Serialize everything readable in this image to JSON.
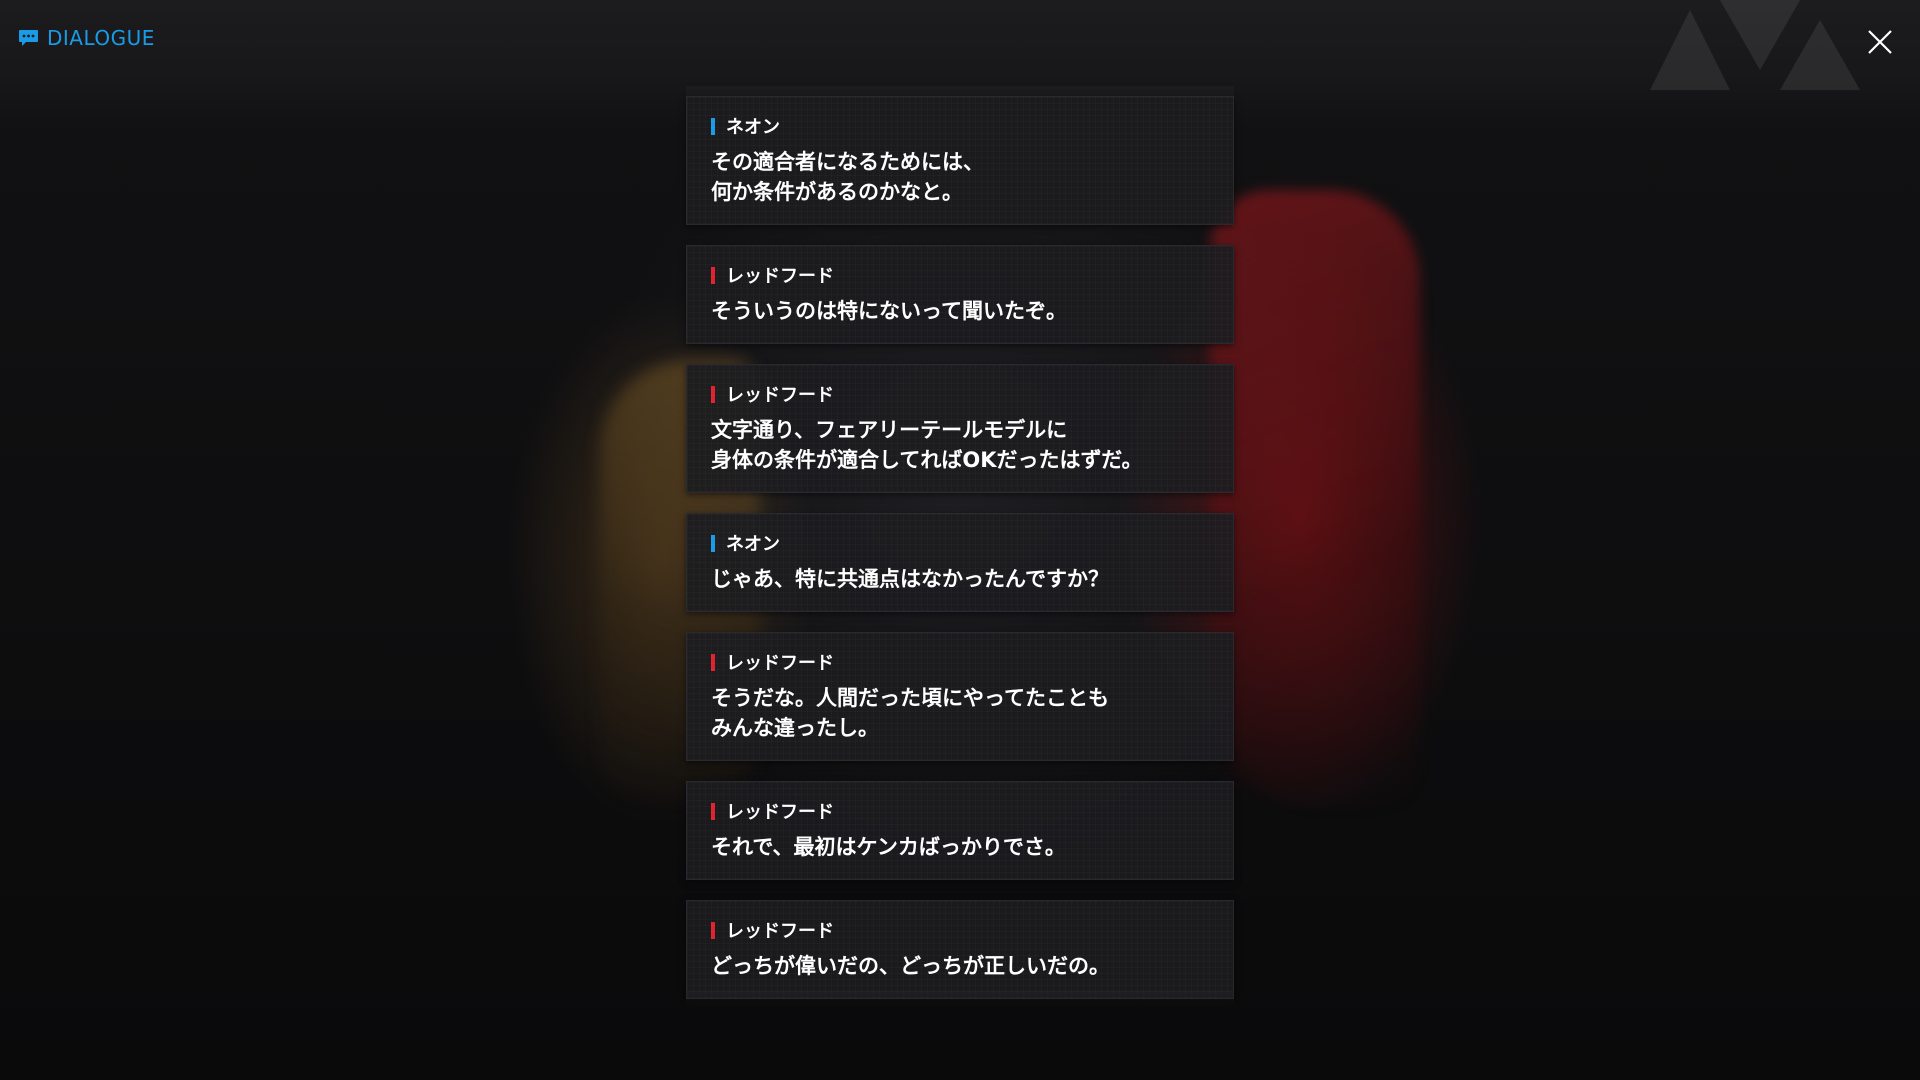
{
  "header": {
    "title": "DIALOGUE",
    "title_icon": "chat-bubble-icon",
    "close_icon": "close-icon",
    "accent_color": "#1a9be8"
  },
  "speaker_colors": {
    "ネオン": "#1a9be8",
    "レッドフード": "#e0222e"
  },
  "dialogue": [
    {
      "speaker": "ネオン",
      "speaker_color": "#1a9be8",
      "text": "その適合者になるためには、\n何か条件があるのかなと。"
    },
    {
      "speaker": "レッドフード",
      "speaker_color": "#e0222e",
      "text": "そういうのは特にないって聞いたぞ。"
    },
    {
      "speaker": "レッドフード",
      "speaker_color": "#e0222e",
      "text": "文字通り、フェアリーテールモデルに\n身体の条件が適合してればOKだったはずだ。"
    },
    {
      "speaker": "ネオン",
      "speaker_color": "#1a9be8",
      "text": "じゃあ、特に共通点はなかったんですか？"
    },
    {
      "speaker": "レッドフード",
      "speaker_color": "#e0222e",
      "text": "そうだな。人間だった頃にやってたことも\nみんな違ったし。"
    },
    {
      "speaker": "レッドフード",
      "speaker_color": "#e0222e",
      "text": "それで、最初はケンカばっかりでさ。"
    },
    {
      "speaker": "レッドフード",
      "speaker_color": "#e0222e",
      "text": "どっちが偉いだの、どっちが正しいだの。"
    }
  ]
}
